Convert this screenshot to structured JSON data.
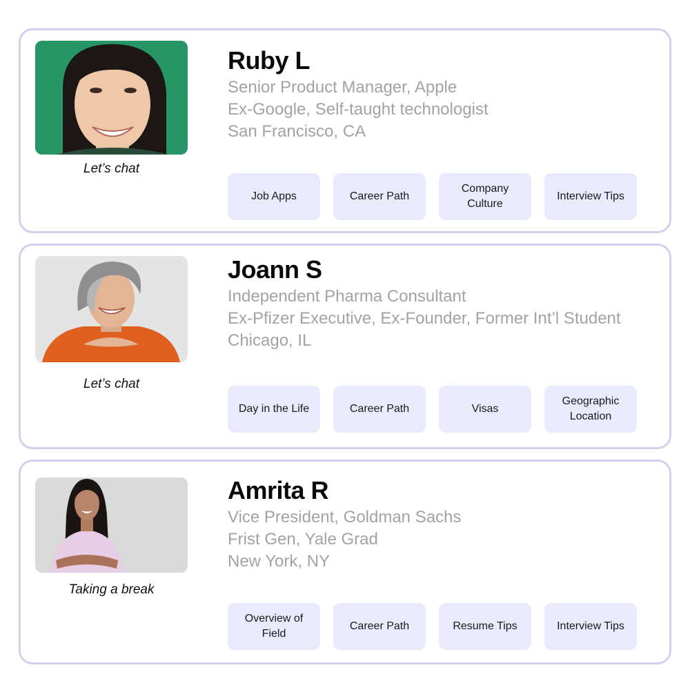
{
  "mentors": [
    {
      "name": "Ruby L",
      "details": [
        "Senior Product Manager, Apple",
        "Ex-Google, Self-taught technologist",
        "San Francisco, CA"
      ],
      "status": "Let’s chat",
      "tags": [
        "Job Apps",
        "Career Path",
        "Company Culture",
        "Interview Tips"
      ],
      "photo_background": "#2d9c6e"
    },
    {
      "name": "Joann S",
      "details": [
        "Independent Pharma Consultant",
        "Ex-Pfizer Executive, Ex-Founder, Former Int’l Student",
        "Chicago, IL"
      ],
      "status": "Let’s chat",
      "tags": [
        "Day in the Life",
        "Career Path",
        "Visas",
        "Geographic Location"
      ],
      "photo_background": "#e4e4e4"
    },
    {
      "name": "Amrita R",
      "details": [
        "Vice President, Goldman Sachs",
        "Frist Gen, Yale Grad",
        "New York, NY"
      ],
      "status": "Taking a break",
      "tags": [
        "Overview of Field",
        "Career Path",
        "Resume Tips",
        "Interview Tips"
      ],
      "photo_background": "#dadada"
    }
  ],
  "colors": {
    "card_border": "#d7cdee",
    "tag_background": "#e9ebfc",
    "detail_text": "#a3a3a3"
  }
}
